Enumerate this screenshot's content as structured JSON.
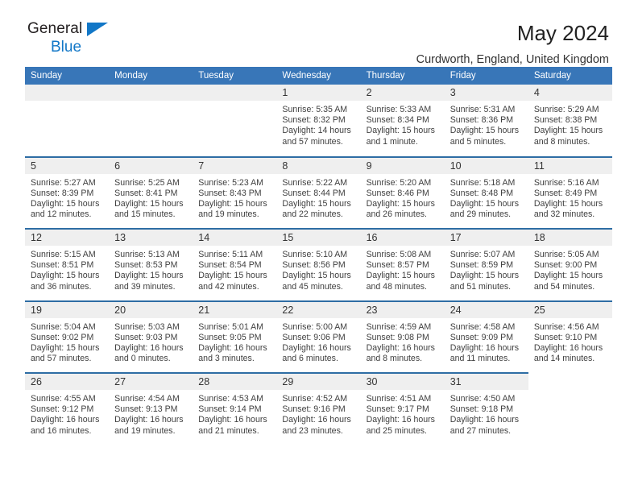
{
  "brand": {
    "name_top": "General",
    "name_bottom": "Blue",
    "triangle_icon": "triangle-icon",
    "accent_color": "#1277c7"
  },
  "header": {
    "title": "May 2024",
    "subtitle": "Curdworth, England, United Kingdom"
  },
  "theme": {
    "header_bg": "#3876b8",
    "row_divider": "#2e6da4",
    "daynum_bg": "#efefef"
  },
  "weekday_headers": [
    "Sunday",
    "Monday",
    "Tuesday",
    "Wednesday",
    "Thursday",
    "Friday",
    "Saturday"
  ],
  "labels": {
    "sunrise": "Sunrise:",
    "sunset": "Sunset:",
    "daylight": "Daylight:"
  },
  "weeks": [
    {
      "days": [
        {
          "num": "",
          "blank": true
        },
        {
          "num": "",
          "blank": true
        },
        {
          "num": "",
          "blank": true
        },
        {
          "num": "1",
          "sunrise": "Sunrise: 5:35 AM",
          "sunset": "Sunset: 8:32 PM",
          "daylight": "Daylight: 14 hours and 57 minutes."
        },
        {
          "num": "2",
          "sunrise": "Sunrise: 5:33 AM",
          "sunset": "Sunset: 8:34 PM",
          "daylight": "Daylight: 15 hours and 1 minute."
        },
        {
          "num": "3",
          "sunrise": "Sunrise: 5:31 AM",
          "sunset": "Sunset: 8:36 PM",
          "daylight": "Daylight: 15 hours and 5 minutes."
        },
        {
          "num": "4",
          "sunrise": "Sunrise: 5:29 AM",
          "sunset": "Sunset: 8:38 PM",
          "daylight": "Daylight: 15 hours and 8 minutes."
        }
      ]
    },
    {
      "days": [
        {
          "num": "5",
          "sunrise": "Sunrise: 5:27 AM",
          "sunset": "Sunset: 8:39 PM",
          "daylight": "Daylight: 15 hours and 12 minutes."
        },
        {
          "num": "6",
          "sunrise": "Sunrise: 5:25 AM",
          "sunset": "Sunset: 8:41 PM",
          "daylight": "Daylight: 15 hours and 15 minutes."
        },
        {
          "num": "7",
          "sunrise": "Sunrise: 5:23 AM",
          "sunset": "Sunset: 8:43 PM",
          "daylight": "Daylight: 15 hours and 19 minutes."
        },
        {
          "num": "8",
          "sunrise": "Sunrise: 5:22 AM",
          "sunset": "Sunset: 8:44 PM",
          "daylight": "Daylight: 15 hours and 22 minutes."
        },
        {
          "num": "9",
          "sunrise": "Sunrise: 5:20 AM",
          "sunset": "Sunset: 8:46 PM",
          "daylight": "Daylight: 15 hours and 26 minutes."
        },
        {
          "num": "10",
          "sunrise": "Sunrise: 5:18 AM",
          "sunset": "Sunset: 8:48 PM",
          "daylight": "Daylight: 15 hours and 29 minutes."
        },
        {
          "num": "11",
          "sunrise": "Sunrise: 5:16 AM",
          "sunset": "Sunset: 8:49 PM",
          "daylight": "Daylight: 15 hours and 32 minutes."
        }
      ]
    },
    {
      "days": [
        {
          "num": "12",
          "sunrise": "Sunrise: 5:15 AM",
          "sunset": "Sunset: 8:51 PM",
          "daylight": "Daylight: 15 hours and 36 minutes."
        },
        {
          "num": "13",
          "sunrise": "Sunrise: 5:13 AM",
          "sunset": "Sunset: 8:53 PM",
          "daylight": "Daylight: 15 hours and 39 minutes."
        },
        {
          "num": "14",
          "sunrise": "Sunrise: 5:11 AM",
          "sunset": "Sunset: 8:54 PM",
          "daylight": "Daylight: 15 hours and 42 minutes."
        },
        {
          "num": "15",
          "sunrise": "Sunrise: 5:10 AM",
          "sunset": "Sunset: 8:56 PM",
          "daylight": "Daylight: 15 hours and 45 minutes."
        },
        {
          "num": "16",
          "sunrise": "Sunrise: 5:08 AM",
          "sunset": "Sunset: 8:57 PM",
          "daylight": "Daylight: 15 hours and 48 minutes."
        },
        {
          "num": "17",
          "sunrise": "Sunrise: 5:07 AM",
          "sunset": "Sunset: 8:59 PM",
          "daylight": "Daylight: 15 hours and 51 minutes."
        },
        {
          "num": "18",
          "sunrise": "Sunrise: 5:05 AM",
          "sunset": "Sunset: 9:00 PM",
          "daylight": "Daylight: 15 hours and 54 minutes."
        }
      ]
    },
    {
      "days": [
        {
          "num": "19",
          "sunrise": "Sunrise: 5:04 AM",
          "sunset": "Sunset: 9:02 PM",
          "daylight": "Daylight: 15 hours and 57 minutes."
        },
        {
          "num": "20",
          "sunrise": "Sunrise: 5:03 AM",
          "sunset": "Sunset: 9:03 PM",
          "daylight": "Daylight: 16 hours and 0 minutes."
        },
        {
          "num": "21",
          "sunrise": "Sunrise: 5:01 AM",
          "sunset": "Sunset: 9:05 PM",
          "daylight": "Daylight: 16 hours and 3 minutes."
        },
        {
          "num": "22",
          "sunrise": "Sunrise: 5:00 AM",
          "sunset": "Sunset: 9:06 PM",
          "daylight": "Daylight: 16 hours and 6 minutes."
        },
        {
          "num": "23",
          "sunrise": "Sunrise: 4:59 AM",
          "sunset": "Sunset: 9:08 PM",
          "daylight": "Daylight: 16 hours and 8 minutes."
        },
        {
          "num": "24",
          "sunrise": "Sunrise: 4:58 AM",
          "sunset": "Sunset: 9:09 PM",
          "daylight": "Daylight: 16 hours and 11 minutes."
        },
        {
          "num": "25",
          "sunrise": "Sunrise: 4:56 AM",
          "sunset": "Sunset: 9:10 PM",
          "daylight": "Daylight: 16 hours and 14 minutes."
        }
      ]
    },
    {
      "days": [
        {
          "num": "26",
          "sunrise": "Sunrise: 4:55 AM",
          "sunset": "Sunset: 9:12 PM",
          "daylight": "Daylight: 16 hours and 16 minutes."
        },
        {
          "num": "27",
          "sunrise": "Sunrise: 4:54 AM",
          "sunset": "Sunset: 9:13 PM",
          "daylight": "Daylight: 16 hours and 19 minutes."
        },
        {
          "num": "28",
          "sunrise": "Sunrise: 4:53 AM",
          "sunset": "Sunset: 9:14 PM",
          "daylight": "Daylight: 16 hours and 21 minutes."
        },
        {
          "num": "29",
          "sunrise": "Sunrise: 4:52 AM",
          "sunset": "Sunset: 9:16 PM",
          "daylight": "Daylight: 16 hours and 23 minutes."
        },
        {
          "num": "30",
          "sunrise": "Sunrise: 4:51 AM",
          "sunset": "Sunset: 9:17 PM",
          "daylight": "Daylight: 16 hours and 25 minutes."
        },
        {
          "num": "31",
          "sunrise": "Sunrise: 4:50 AM",
          "sunset": "Sunset: 9:18 PM",
          "daylight": "Daylight: 16 hours and 27 minutes."
        },
        {
          "num": "",
          "blank": true,
          "trailing": true
        }
      ]
    }
  ]
}
